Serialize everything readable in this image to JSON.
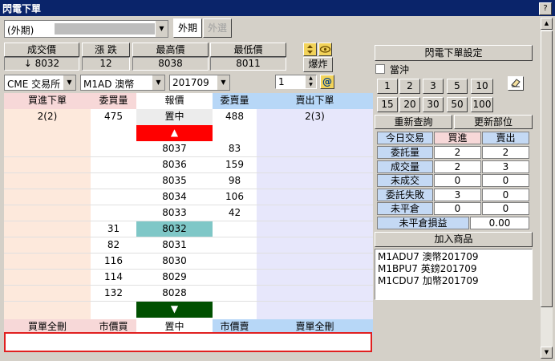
{
  "window": {
    "title": "閃電下單",
    "help": "?"
  },
  "market_combo": {
    "value": "(外期)",
    "masked_text": ""
  },
  "market_tabs": [
    "外期",
    "外選"
  ],
  "quote_headers": [
    "成交價",
    "漲 跌",
    "最高價",
    "最低價"
  ],
  "quote_values": [
    "↓ 8032",
    "12",
    "8038",
    "8011"
  ],
  "exchange_combo": "CME 交易所",
  "product_combo": "M1AD 澳幣",
  "month_combo": "201709",
  "quantity": "1",
  "burst_button": "爆炸",
  "ladder": {
    "headers": [
      "買進下單",
      "委買量",
      "報價",
      "委賣量",
      "賣出下單"
    ],
    "summary": {
      "buy_order": "2(2)",
      "bid_qty": "475",
      "price": "置中",
      "ask_qty": "488",
      "sell_order": "2(3)"
    },
    "up_arrow": "▲",
    "down_arrow": "▼",
    "rows": [
      {
        "bid": "",
        "price": "8037",
        "ask": "83"
      },
      {
        "bid": "",
        "price": "8036",
        "ask": "159"
      },
      {
        "bid": "",
        "price": "8035",
        "ask": "98"
      },
      {
        "bid": "",
        "price": "8034",
        "ask": "106"
      },
      {
        "bid": "",
        "price": "8033",
        "ask": "42"
      },
      {
        "bid": "31",
        "price": "8032",
        "ask": ""
      },
      {
        "bid": "82",
        "price": "8031",
        "ask": ""
      },
      {
        "bid": "116",
        "price": "8030",
        "ask": ""
      },
      {
        "bid": "114",
        "price": "8029",
        "ask": ""
      },
      {
        "bid": "132",
        "price": "8028",
        "ask": ""
      }
    ],
    "footer": [
      "買單全刪",
      "市價買",
      "置中",
      "市價賣",
      "賣單全刪"
    ]
  },
  "right": {
    "settings_button": "閃電下單設定",
    "daytrade_label": "當沖",
    "qty_buttons_row1": [
      "1",
      "2",
      "3",
      "5",
      "10"
    ],
    "qty_buttons_row2": [
      "15",
      "20",
      "30",
      "50",
      "100"
    ],
    "requery_button": "重新查詢",
    "update_position_button": "更新部位",
    "stats_header": [
      "今日交易",
      "買進",
      "賣出"
    ],
    "stats_rows": [
      {
        "label": "委託量",
        "buy": "2",
        "sell": "2"
      },
      {
        "label": "成交量",
        "buy": "2",
        "sell": "3"
      },
      {
        "label": "未成交",
        "buy": "0",
        "sell": "0"
      },
      {
        "label": "委託失敗",
        "buy": "3",
        "sell": "0"
      },
      {
        "label": "未平倉",
        "buy": "0",
        "sell": "0"
      }
    ],
    "unrealized_label": "未平倉損益",
    "unrealized_value": "0.00",
    "add_product_button": "加入商品",
    "product_list": [
      "M1ADU7 澳幣201709",
      "M1BPU7 英鎊201709",
      "M1CDU7 加幣201709"
    ]
  },
  "colors": {
    "title_bar": "#0a246a",
    "up_bar": "#ff0000",
    "down_bar": "#005000",
    "highlight": "#7fc7c7",
    "message_border": "#e02020"
  }
}
